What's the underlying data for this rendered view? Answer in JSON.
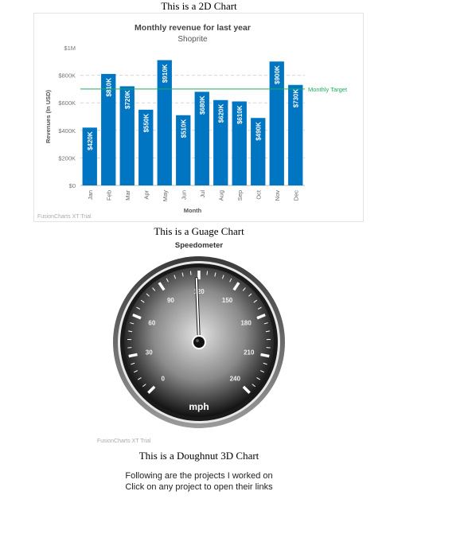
{
  "headings": {
    "bar": "This is a 2D Chart",
    "gauge": "This is a Guage Chart",
    "doughnut": "This is a Doughnut 3D Chart"
  },
  "footer": {
    "line1": "Following are the projects I worked on",
    "line2": "Click on any project to open their links"
  },
  "chart_data": [
    {
      "type": "bar",
      "title": "Monthly revenue for last year",
      "subtitle": "Shoprite",
      "xlabel": "Month",
      "ylabel": "Revenues (In USD)",
      "categories": [
        "Jan",
        "Feb",
        "Mar",
        "Apr",
        "May",
        "Jun",
        "Jul",
        "Aug",
        "Sep",
        "Oct",
        "Nov",
        "Dec"
      ],
      "values": [
        420000,
        810000,
        720000,
        550000,
        910000,
        510000,
        680000,
        620000,
        610000,
        490000,
        900000,
        730000
      ],
      "data_labels": [
        "$420K",
        "$810K",
        "$720K",
        "$550K",
        "$910K",
        "$510K",
        "$680K",
        "$620K",
        "$610K",
        "$490K",
        "$900K",
        "$730K"
      ],
      "yticks": [
        {
          "value": 0,
          "label": "$0"
        },
        {
          "value": 200000,
          "label": "$200K"
        },
        {
          "value": 400000,
          "label": "$400K"
        },
        {
          "value": 600000,
          "label": "$600K"
        },
        {
          "value": 800000,
          "label": "$800K"
        },
        {
          "value": 1000000,
          "label": "$1M"
        }
      ],
      "ylim": [
        0,
        1000000
      ],
      "trendline": {
        "value": 700000,
        "label": "Monthly Target",
        "color": "#1aaf5d"
      },
      "bar_color": "#0075c2",
      "watermark": "FusionCharts XT Trial"
    },
    {
      "type": "gauge",
      "title": "Speedometer",
      "unit": "mph",
      "min": 0,
      "max": 240,
      "tick_labels": [
        0,
        30,
        60,
        90,
        120,
        150,
        180,
        210,
        240
      ],
      "value": 118,
      "watermark": "FusionCharts XT Trial"
    }
  ]
}
